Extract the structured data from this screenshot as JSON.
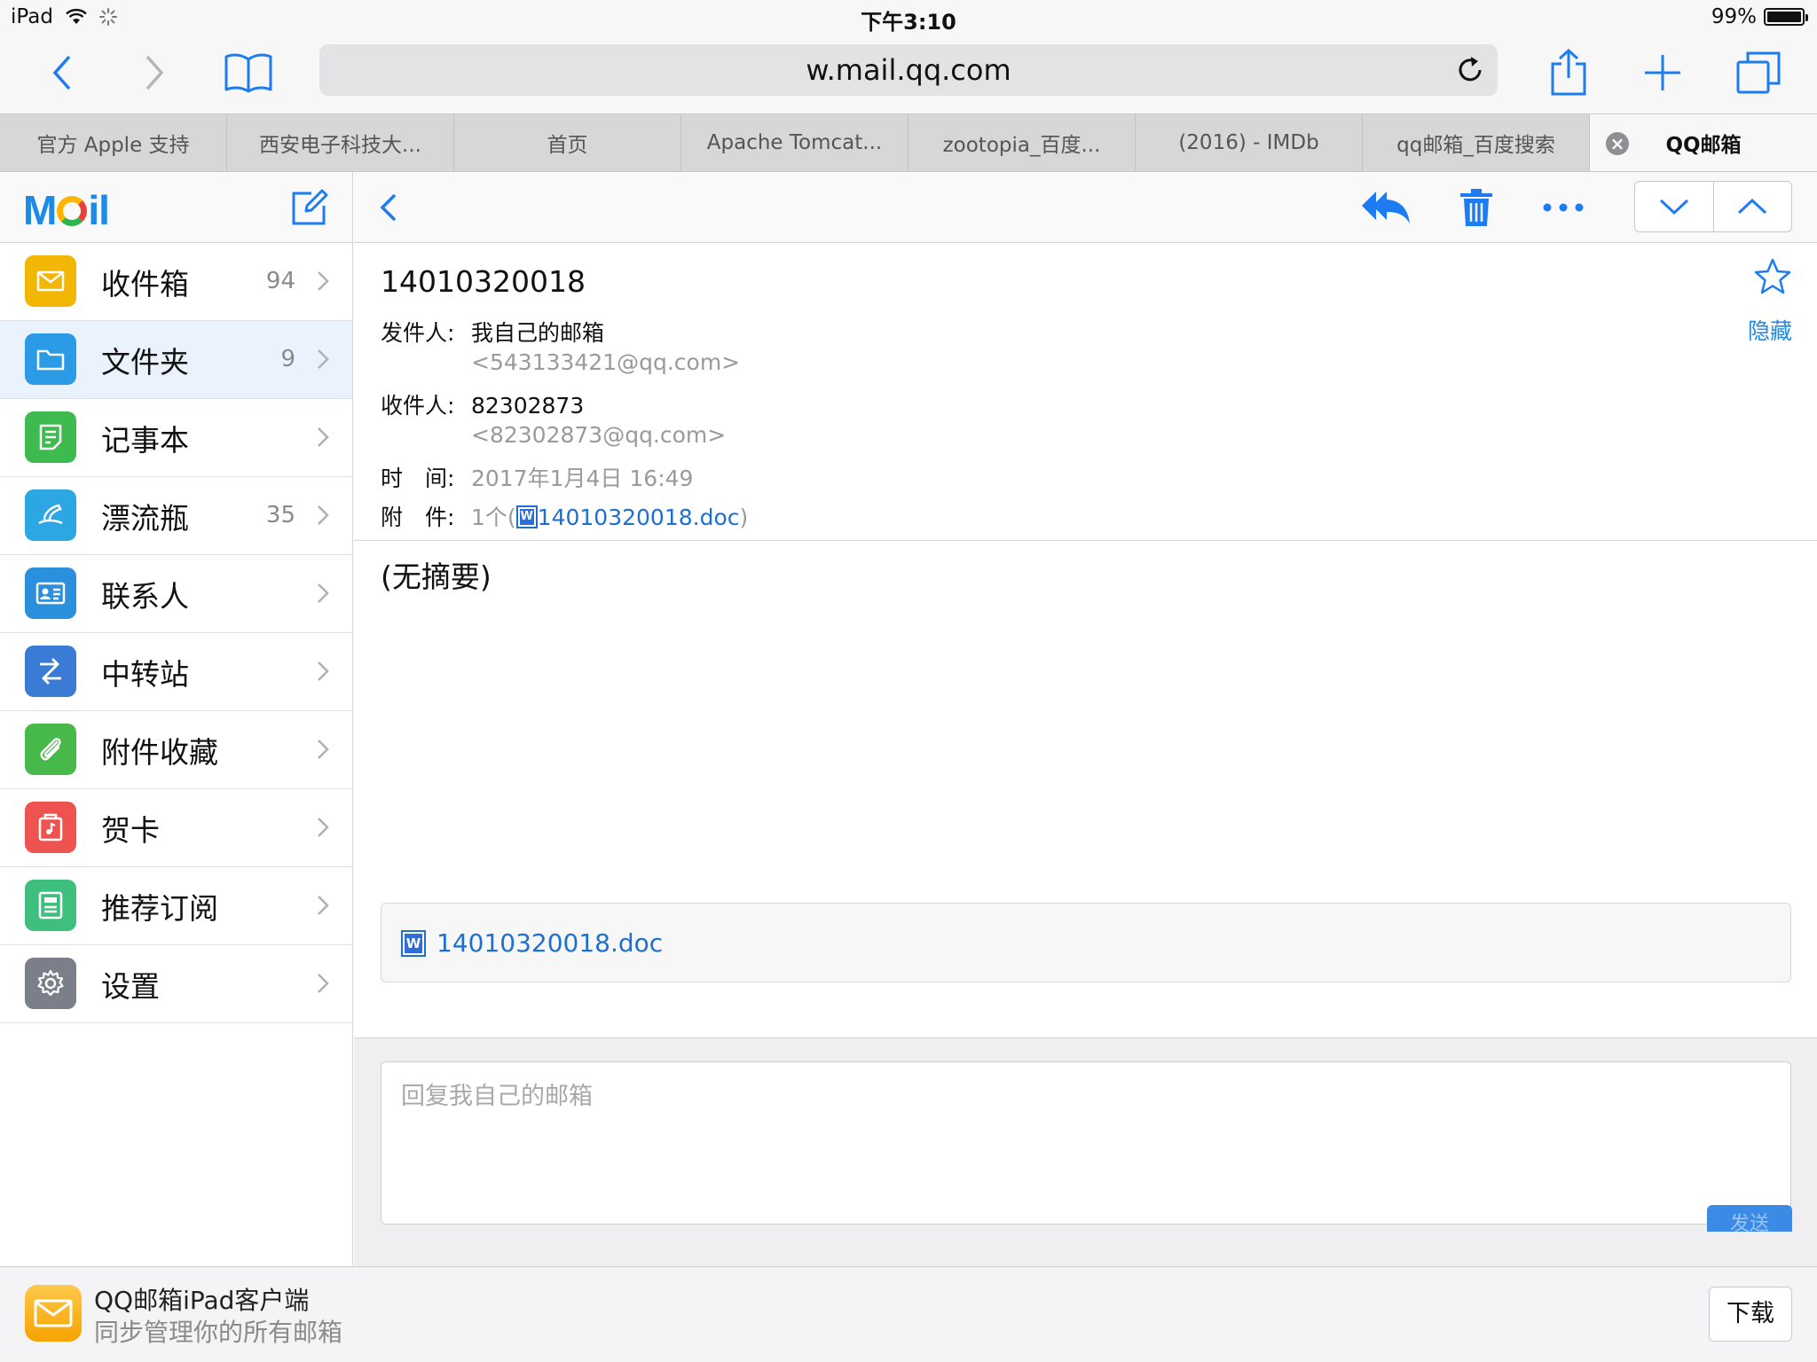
{
  "status": {
    "device": "iPad",
    "time": "下午3:10",
    "battery": "99%",
    "battery_level": 0.99
  },
  "browser": {
    "url": "w.mail.qq.com",
    "tabs": [
      "官方 Apple 支持",
      "西安电子科技大...",
      "首页",
      "Apache Tomcat...",
      "zootopia_百度...",
      "(2016) - IMDb",
      "qq邮箱_百度搜索",
      "QQ邮箱"
    ],
    "active_tab_close": "×"
  },
  "sidebar": {
    "logo_left": "M",
    "logo_right": "il",
    "items": [
      {
        "label": "收件箱",
        "count": "94",
        "color": "#f2b705",
        "icon": "envelope-icon"
      },
      {
        "label": "文件夹",
        "count": "9",
        "color": "#2b9be8",
        "icon": "folder-icon"
      },
      {
        "label": "记事本",
        "count": "",
        "color": "#3dbb4f",
        "icon": "note-icon"
      },
      {
        "label": "漂流瓶",
        "count": "35",
        "color": "#2da7e4",
        "icon": "drift-bottle-icon"
      },
      {
        "label": "联系人",
        "count": "",
        "color": "#2a8fdd",
        "icon": "contact-card-icon"
      },
      {
        "label": "中转站",
        "count": "",
        "color": "#3a7bd5",
        "icon": "transfer-icon"
      },
      {
        "label": "附件收藏",
        "count": "",
        "color": "#47b84a",
        "icon": "paperclip-icon"
      },
      {
        "label": "贺卡",
        "count": "",
        "color": "#ef5350",
        "icon": "card-icon"
      },
      {
        "label": "推荐订阅",
        "count": "",
        "color": "#3fbf7f",
        "icon": "newspaper-icon"
      },
      {
        "label": "设置",
        "count": "",
        "color": "#7a7f8a",
        "icon": "gear-icon"
      }
    ]
  },
  "mail": {
    "subject": "14010320018",
    "hide_label": "隐藏",
    "from_key": "发件人:",
    "from_name": "我自己的邮箱",
    "from_addr": "<543133421@qq.com>",
    "to_key": "收件人:",
    "to_name": "82302873",
    "to_addr": "<82302873@qq.com>",
    "time_key": "时　间:",
    "time_value": "2017年1月4日 16:49",
    "attach_key": "附　件:",
    "attach_count": "1个(",
    "attach_name": "14010320018.doc",
    "attach_close": ")",
    "summary": "(无摘要)",
    "attachment_file": "14010320018.doc",
    "reply_placeholder": "回复我自己的邮箱",
    "send_label": "发送"
  },
  "banner": {
    "title": "QQ邮箱iPad客户端",
    "subtitle": "同步管理你的所有邮箱",
    "download": "下载"
  }
}
